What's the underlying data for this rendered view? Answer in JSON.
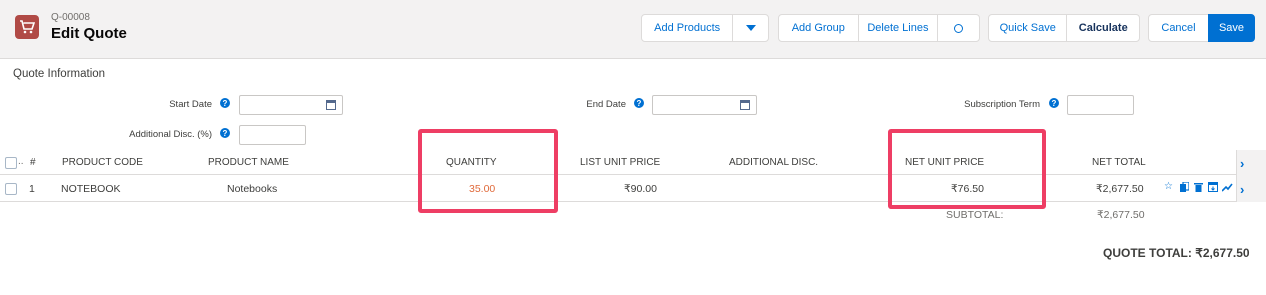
{
  "header": {
    "record_id": "Q-00008",
    "title": "Edit Quote",
    "icon": "cart-icon"
  },
  "toolbar": {
    "add_products": "Add Products",
    "add_group": "Add Group",
    "delete_lines": "Delete Lines",
    "quick_save": "Quick Save",
    "calculate": "Calculate",
    "cancel": "Cancel",
    "save": "Save"
  },
  "quote_info": {
    "title": "Quote Information",
    "start_date_label": "Start Date",
    "end_date_label": "End Date",
    "subscription_term_label": "Subscription Term",
    "additional_disc_label": "Additional Disc. (%)"
  },
  "table": {
    "columns": {
      "num": "#",
      "product_code": "PRODUCT CODE",
      "product_name": "PRODUCT NAME",
      "quantity": "QUANTITY",
      "list_unit_price": "LIST UNIT PRICE",
      "additional_disc": "ADDITIONAL DISC.",
      "net_unit_price": "NET UNIT PRICE",
      "net_total": "NET TOTAL"
    },
    "rows": [
      {
        "num": "1",
        "product_code": "NOTEBOOK",
        "product_name": "Notebooks",
        "quantity": "35.00",
        "list_unit_price": "₹90.00",
        "additional_disc": "",
        "net_unit_price": "₹76.50",
        "net_total": "₹2,677.50"
      }
    ]
  },
  "summary": {
    "subtotal_label": "SUBTOTAL:",
    "subtotal_value": "₹2,677.50",
    "quote_total": "QUOTE TOTAL: ₹2,677.50"
  },
  "colors": {
    "brand_blue": "#0070d2",
    "highlight": "#ee3e64",
    "quantity_text": "#e06a3b",
    "icon_bg": "#b04a46"
  }
}
